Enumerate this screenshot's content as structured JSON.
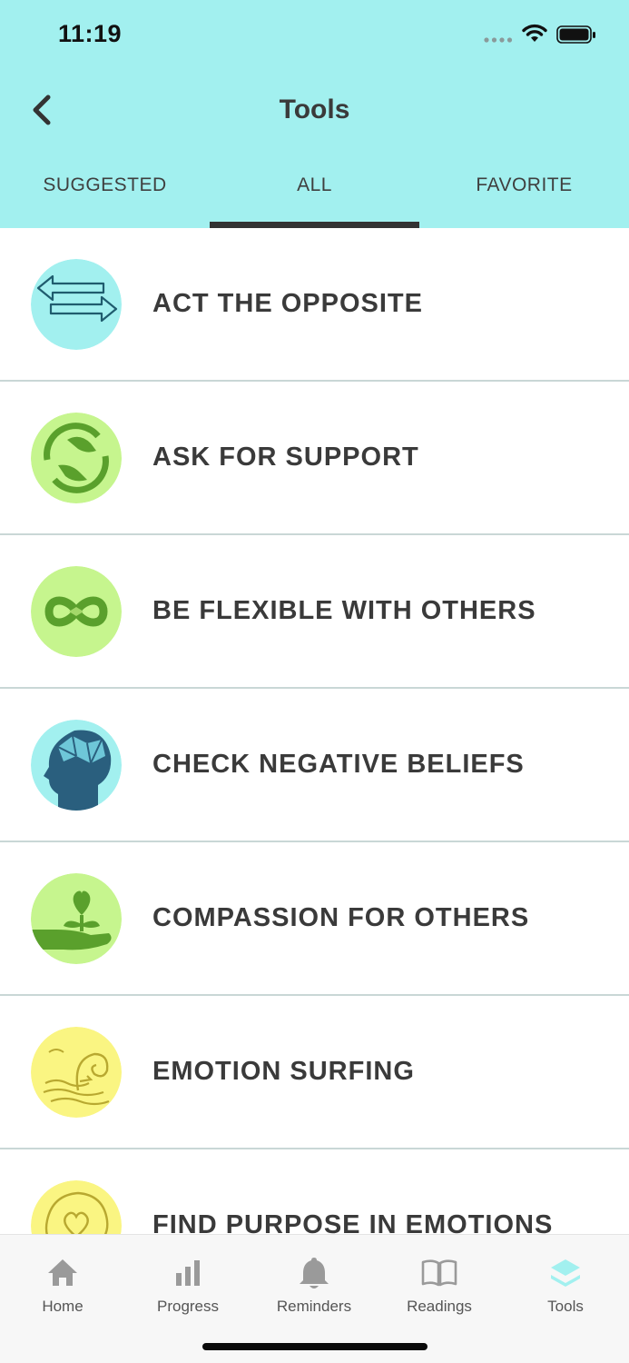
{
  "status_bar": {
    "time": "11:19"
  },
  "header": {
    "title": "Tools"
  },
  "tabs": [
    {
      "label": "SUGGESTED"
    },
    {
      "label": "ALL"
    },
    {
      "label": "FAVORITE"
    }
  ],
  "active_tab": "ALL",
  "tools": [
    {
      "label": "ACT THE OPPOSITE",
      "icon": "opposite-arrows-icon",
      "bg": "#a2f0ef"
    },
    {
      "label": "ASK FOR SUPPORT",
      "icon": "support-hands-icon",
      "bg": "#c6f58e"
    },
    {
      "label": "BE FLEXIBLE WITH OTHERS",
      "icon": "infinity-handshake-icon",
      "bg": "#c6f58e"
    },
    {
      "label": "CHECK NEGATIVE BELIEFS",
      "icon": "head-brain-icon",
      "bg": "#a2f0ef"
    },
    {
      "label": "COMPASSION FOR OTHERS",
      "icon": "hand-heart-plant-icon",
      "bg": "#c6f58e"
    },
    {
      "label": "EMOTION SURFING",
      "icon": "wave-surfer-icon",
      "bg": "#faf582"
    },
    {
      "label": "FIND PURPOSE IN EMOTIONS",
      "icon": "head-heart-icon",
      "bg": "#faf582"
    }
  ],
  "tabbar": [
    {
      "label": "Home",
      "icon": "home-icon"
    },
    {
      "label": "Progress",
      "icon": "bar-chart-icon"
    },
    {
      "label": "Reminders",
      "icon": "bell-icon"
    },
    {
      "label": "Readings",
      "icon": "book-icon"
    },
    {
      "label": "Tools",
      "icon": "layers-icon"
    }
  ],
  "colors": {
    "header_bg": "#a2f0ef",
    "active_tab_indicator": "#333333",
    "active_tabbar_icon": "#a2f0ef",
    "inactive_tabbar_icon": "#9a9a9a"
  }
}
